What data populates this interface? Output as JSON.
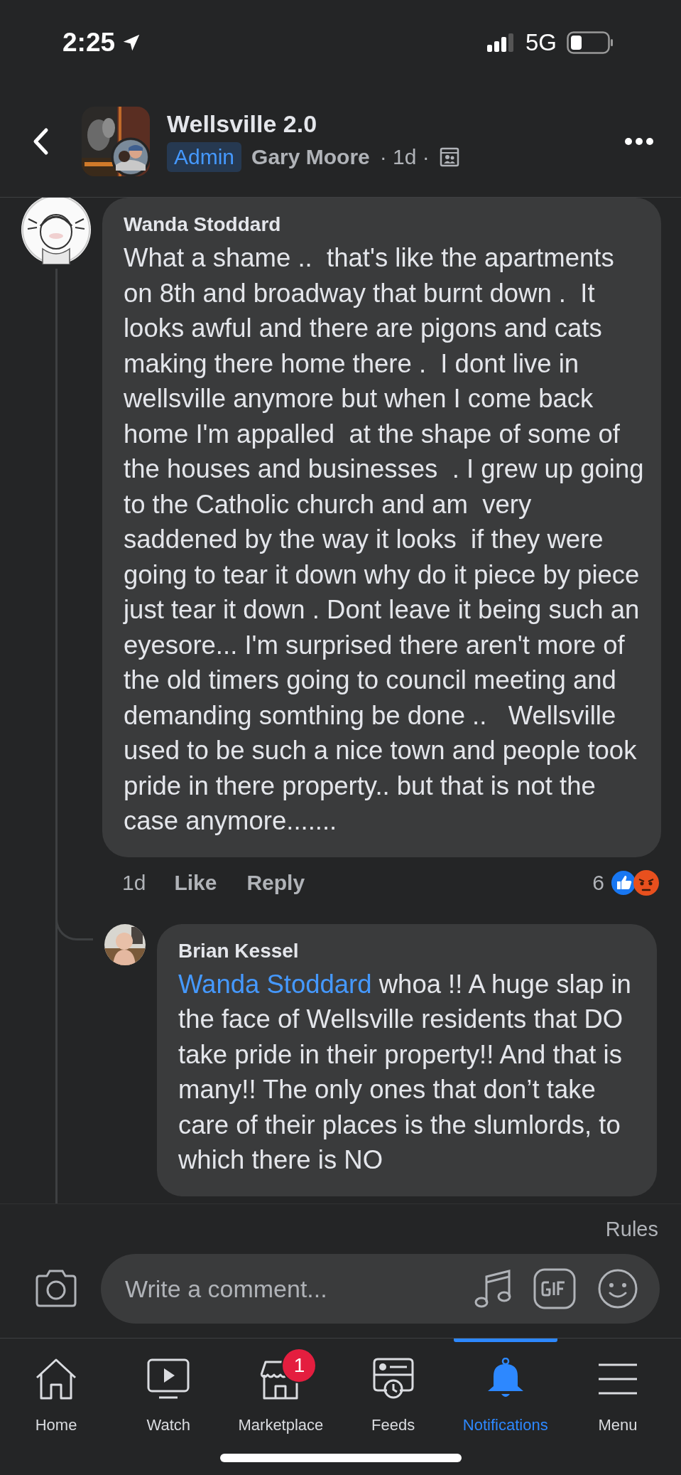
{
  "status_bar": {
    "time": "2:25",
    "network": "5G"
  },
  "header": {
    "title": "Wellsville 2.0",
    "badge": "Admin",
    "author": "Gary Moore",
    "meta": "· 1d ·"
  },
  "comments": [
    {
      "author": "Wanda Stoddard",
      "text": "What a shame ..  that's like the apartments on 8th and broadway that burnt down .  It looks awful and there are pigons and cats making there home there .  I dont live in wellsville anymore but when I come back home I'm appalled  at the shape of some of the houses and businesses  . I grew up going to the Catholic church and am  very saddened by the way it looks  if they were going to tear it down why do it piece by piece  just tear it down . Dont leave it being such an eyesore... I'm surprised there aren't more of the old timers going to council meeting and demanding somthing be done ..   Wellsville used to be such a nice town and people took pride in there property.. but that is not the case anymore.......",
      "time": "1d",
      "actions": [
        "Like",
        "Reply"
      ],
      "reaction_count": "6",
      "replies": [
        {
          "author": "Brian Kessel",
          "mention": "Wanda Stoddard",
          "text": "whoa !! A huge slap in the face of Wellsville residents that DO take pride in their property!! And that is many!! The only ones that don’t take care of their places is the slumlords, to which there is NO"
        }
      ]
    }
  ],
  "composer": {
    "rules": "Rules",
    "placeholder": "Write a comment..."
  },
  "tabs": [
    {
      "kind": "home",
      "label": "Home",
      "selected": false
    },
    {
      "kind": "watch",
      "label": "Watch",
      "selected": false
    },
    {
      "kind": "marketplace",
      "label": "Marketplace",
      "selected": false,
      "badge": "1"
    },
    {
      "kind": "feeds",
      "label": "Feeds",
      "selected": false
    },
    {
      "kind": "notifications",
      "label": "Notifications",
      "selected": true
    },
    {
      "kind": "menu",
      "label": "Menu",
      "selected": false
    }
  ]
}
